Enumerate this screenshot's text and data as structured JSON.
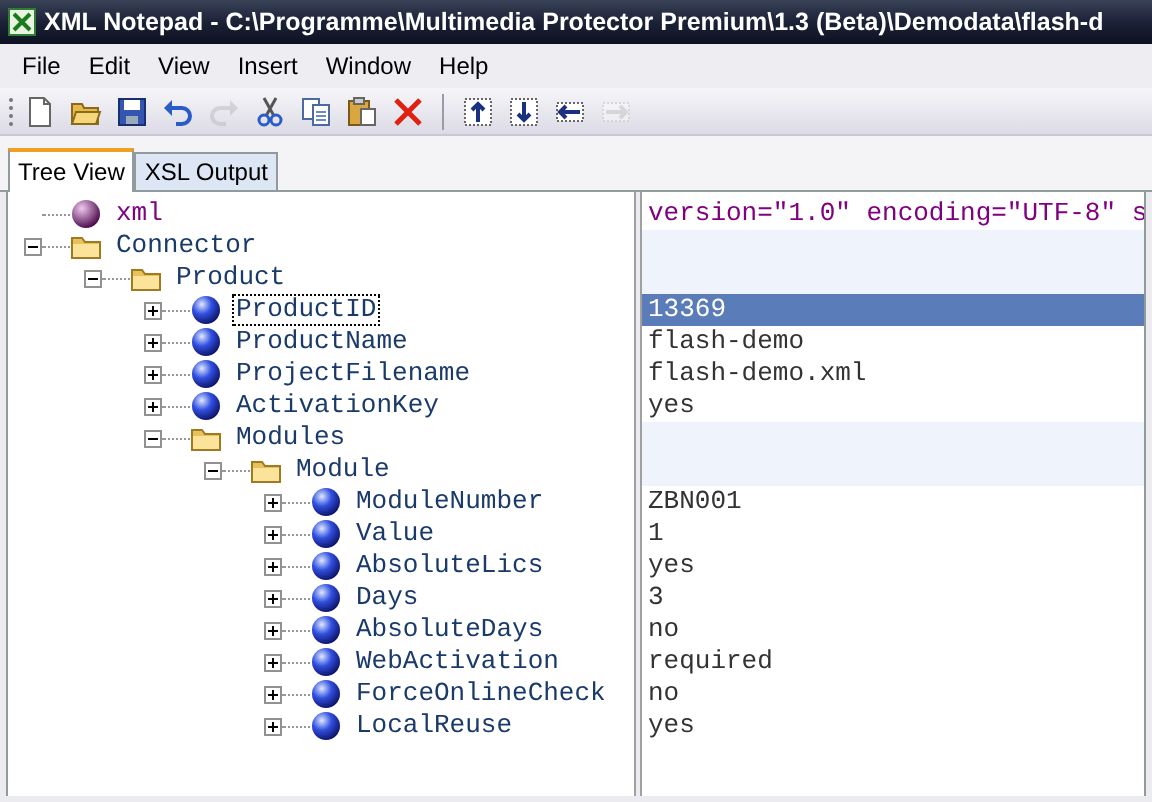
{
  "window": {
    "title": "XML Notepad - C:\\Programme\\Multimedia Protector Premium\\1.3 (Beta)\\Demodata\\flash-d"
  },
  "menu": [
    "File",
    "Edit",
    "View",
    "Insert",
    "Window",
    "Help"
  ],
  "toolbar": [
    {
      "kind": "new",
      "disabled": false
    },
    {
      "kind": "open",
      "disabled": false
    },
    {
      "kind": "save",
      "disabled": false
    },
    {
      "kind": "undo",
      "disabled": false
    },
    {
      "kind": "redo",
      "disabled": true
    },
    {
      "kind": "cut",
      "disabled": false
    },
    {
      "kind": "copy",
      "disabled": false
    },
    {
      "kind": "paste",
      "disabled": false
    },
    {
      "kind": "delete",
      "disabled": false
    },
    {
      "kind": "separator"
    },
    {
      "kind": "nudge-up",
      "disabled": false
    },
    {
      "kind": "nudge-down",
      "disabled": false
    },
    {
      "kind": "nudge-left",
      "disabled": false
    },
    {
      "kind": "nudge-right",
      "disabled": true
    }
  ],
  "tabs": [
    {
      "label": "Tree View",
      "selected": true
    },
    {
      "label": "XSL Output",
      "selected": false
    }
  ],
  "tree": [
    {
      "kind": "instruction",
      "name": "xml",
      "value": "version=\"1.0\" encoding=\"UTF-8\" s",
      "selected": false
    },
    {
      "kind": "folder",
      "name": "Connector",
      "expanded": true,
      "selected": false,
      "children": [
        {
          "kind": "folder",
          "name": "Product",
          "expanded": true,
          "selected": false,
          "children": [
            {
              "kind": "element",
              "name": "ProductID",
              "value": "13369",
              "expanded": false,
              "selected": true
            },
            {
              "kind": "element",
              "name": "ProductName",
              "value": "flash-demo",
              "expanded": false,
              "selected": false
            },
            {
              "kind": "element",
              "name": "ProjectFilename",
              "value": "flash-demo.xml",
              "expanded": false,
              "selected": false
            },
            {
              "kind": "element",
              "name": "ActivationKey",
              "value": "yes",
              "expanded": false,
              "selected": false
            },
            {
              "kind": "folder",
              "name": "Modules",
              "expanded": true,
              "selected": false,
              "children": [
                {
                  "kind": "folder",
                  "name": "Module",
                  "expanded": true,
                  "selected": false,
                  "children": [
                    {
                      "kind": "element",
                      "name": "ModuleNumber",
                      "value": "ZBN001",
                      "expanded": false,
                      "selected": false
                    },
                    {
                      "kind": "element",
                      "name": "Value",
                      "value": "1",
                      "expanded": false,
                      "selected": false
                    },
                    {
                      "kind": "element",
                      "name": "AbsoluteLics",
                      "value": "yes",
                      "expanded": false,
                      "selected": false
                    },
                    {
                      "kind": "element",
                      "name": "Days",
                      "value": "3",
                      "expanded": false,
                      "selected": false
                    },
                    {
                      "kind": "element",
                      "name": "AbsoluteDays",
                      "value": "no",
                      "expanded": false,
                      "selected": false
                    },
                    {
                      "kind": "element",
                      "name": "WebActivation",
                      "value": "required",
                      "expanded": false,
                      "selected": false
                    },
                    {
                      "kind": "element",
                      "name": "ForceOnlineCheck",
                      "value": "no",
                      "expanded": false,
                      "selected": false
                    },
                    {
                      "kind": "element",
                      "name": "LocalReuse",
                      "value": "yes",
                      "expanded": false,
                      "selected": false
                    }
                  ]
                }
              ]
            }
          ]
        }
      ]
    }
  ]
}
